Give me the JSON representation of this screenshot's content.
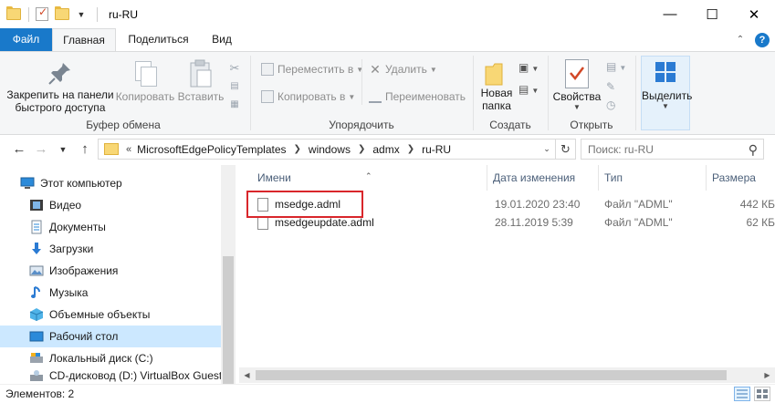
{
  "window": {
    "title": "ru-RU",
    "controls": {
      "minimize": "—",
      "maximize": "☐",
      "close": "✕"
    }
  },
  "ribbon_tabs": [
    {
      "label": "Файл"
    },
    {
      "label": "Главная"
    },
    {
      "label": "Поделиться"
    },
    {
      "label": "Вид"
    }
  ],
  "ribbon": {
    "clipboard": {
      "pin_label": "Закрепить на панели быстрого доступа",
      "copy_label": "Копировать",
      "paste_label": "Вставить",
      "group_label": "Буфер обмена"
    },
    "organize": {
      "move_label": "Переместить в",
      "copyto_label": "Копировать в",
      "delete_label": "Удалить",
      "rename_label": "Переименовать",
      "group_label": "Упорядочить"
    },
    "new": {
      "newfolder_label": "Новая папка",
      "group_label": "Создать"
    },
    "open": {
      "properties_label": "Свойства",
      "group_label": "Открыть"
    },
    "select": {
      "select_label": "Выделить"
    }
  },
  "address": {
    "path": [
      "MicrosoftEdgePolicyTemplates",
      "windows",
      "admx",
      "ru-RU"
    ],
    "overflow": "«"
  },
  "search": {
    "placeholder": "Поиск: ru-RU"
  },
  "nav_pane": {
    "items": [
      {
        "label": "Этот компьютер",
        "icon": "computer-icon"
      },
      {
        "label": "Видео",
        "icon": "video-icon"
      },
      {
        "label": "Документы",
        "icon": "documents-icon"
      },
      {
        "label": "Загрузки",
        "icon": "downloads-icon"
      },
      {
        "label": "Изображения",
        "icon": "pictures-icon"
      },
      {
        "label": "Музыка",
        "icon": "music-icon"
      },
      {
        "label": "Объемные объекты",
        "icon": "3d-objects-icon"
      },
      {
        "label": "Рабочий стол",
        "icon": "desktop-icon",
        "selected": true
      },
      {
        "label": "Локальный диск (C:)",
        "icon": "disk-icon"
      },
      {
        "label": "CD-дисковод (D:) VirtualBox Guest A",
        "icon": "cd-drive-icon"
      }
    ]
  },
  "file_list": {
    "columns": [
      "Имени",
      "Дата изменения",
      "Тип",
      "Размера"
    ],
    "rows": [
      {
        "name": "msedge.adml",
        "date": "19.01.2020 23:40",
        "type": "Файл \"ADML\"",
        "size": "442 КБ"
      },
      {
        "name": "msedgeupdate.adml",
        "date": "28.11.2019 5:39",
        "type": "Файл \"ADML\"",
        "size": "62 КБ"
      }
    ],
    "highlighted_row": 0
  },
  "status_bar": {
    "text": "Элементов: 2"
  },
  "colors": {
    "accent": "#1979ca",
    "selection": "#cce8ff",
    "highlight_box": "#d9262b",
    "folder": "#f8d775"
  }
}
